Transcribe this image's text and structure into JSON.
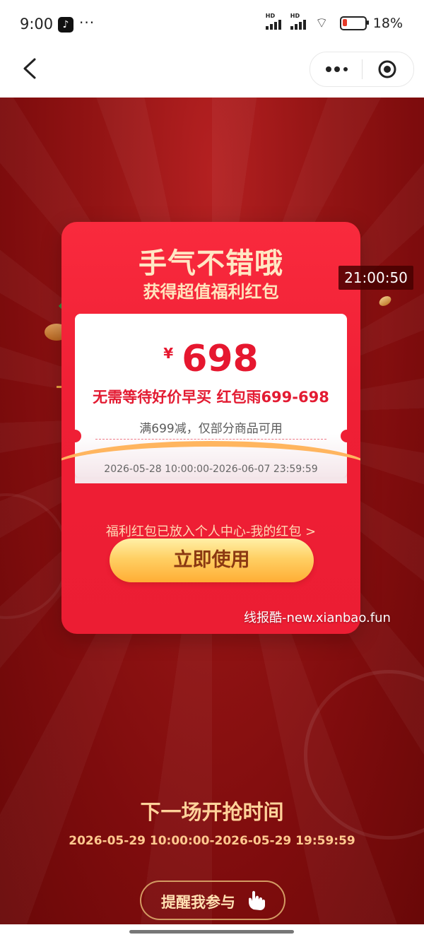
{
  "status_bar": {
    "time": "9:00",
    "app_icon": "tiktok-icon",
    "more": "···",
    "network_labels": [
      "HD",
      "HD"
    ],
    "battery": "18%",
    "battery_level": 0.18
  },
  "navigation": {
    "back_icon": "chevron-left-icon",
    "more_icon": "more-dots-icon",
    "close_icon": "target-circle-icon"
  },
  "reward_card": {
    "title": "手气不错哦",
    "subtitle": "获得超值福利红包",
    "currency": "¥",
    "amount": "698",
    "coupon_name": "无需等待好价早买 红包雨699-698",
    "condition": "满699减，仅部分商品可用",
    "validity": "2026-05-28 10:00:00-2026-06-07 23:59:59",
    "notice": "福利红包已放入个人中心-我的红包 >",
    "button_label": "立即使用"
  },
  "overlay": {
    "video_time": "21:00:50",
    "watermark": "线报酷-new.xianbao.fun"
  },
  "next_round": {
    "title": "下一场开抢时间",
    "time": "2026-05-29 10:00:00-2026-05-29 19:59:59",
    "remind_label": "提醒我参与"
  },
  "colors": {
    "background": "#7e0c0d",
    "card_red": "#ef1f35",
    "gold_text": "#ffe7c4",
    "button_gold": "#ffd064",
    "accent_red": "#e6172f"
  }
}
